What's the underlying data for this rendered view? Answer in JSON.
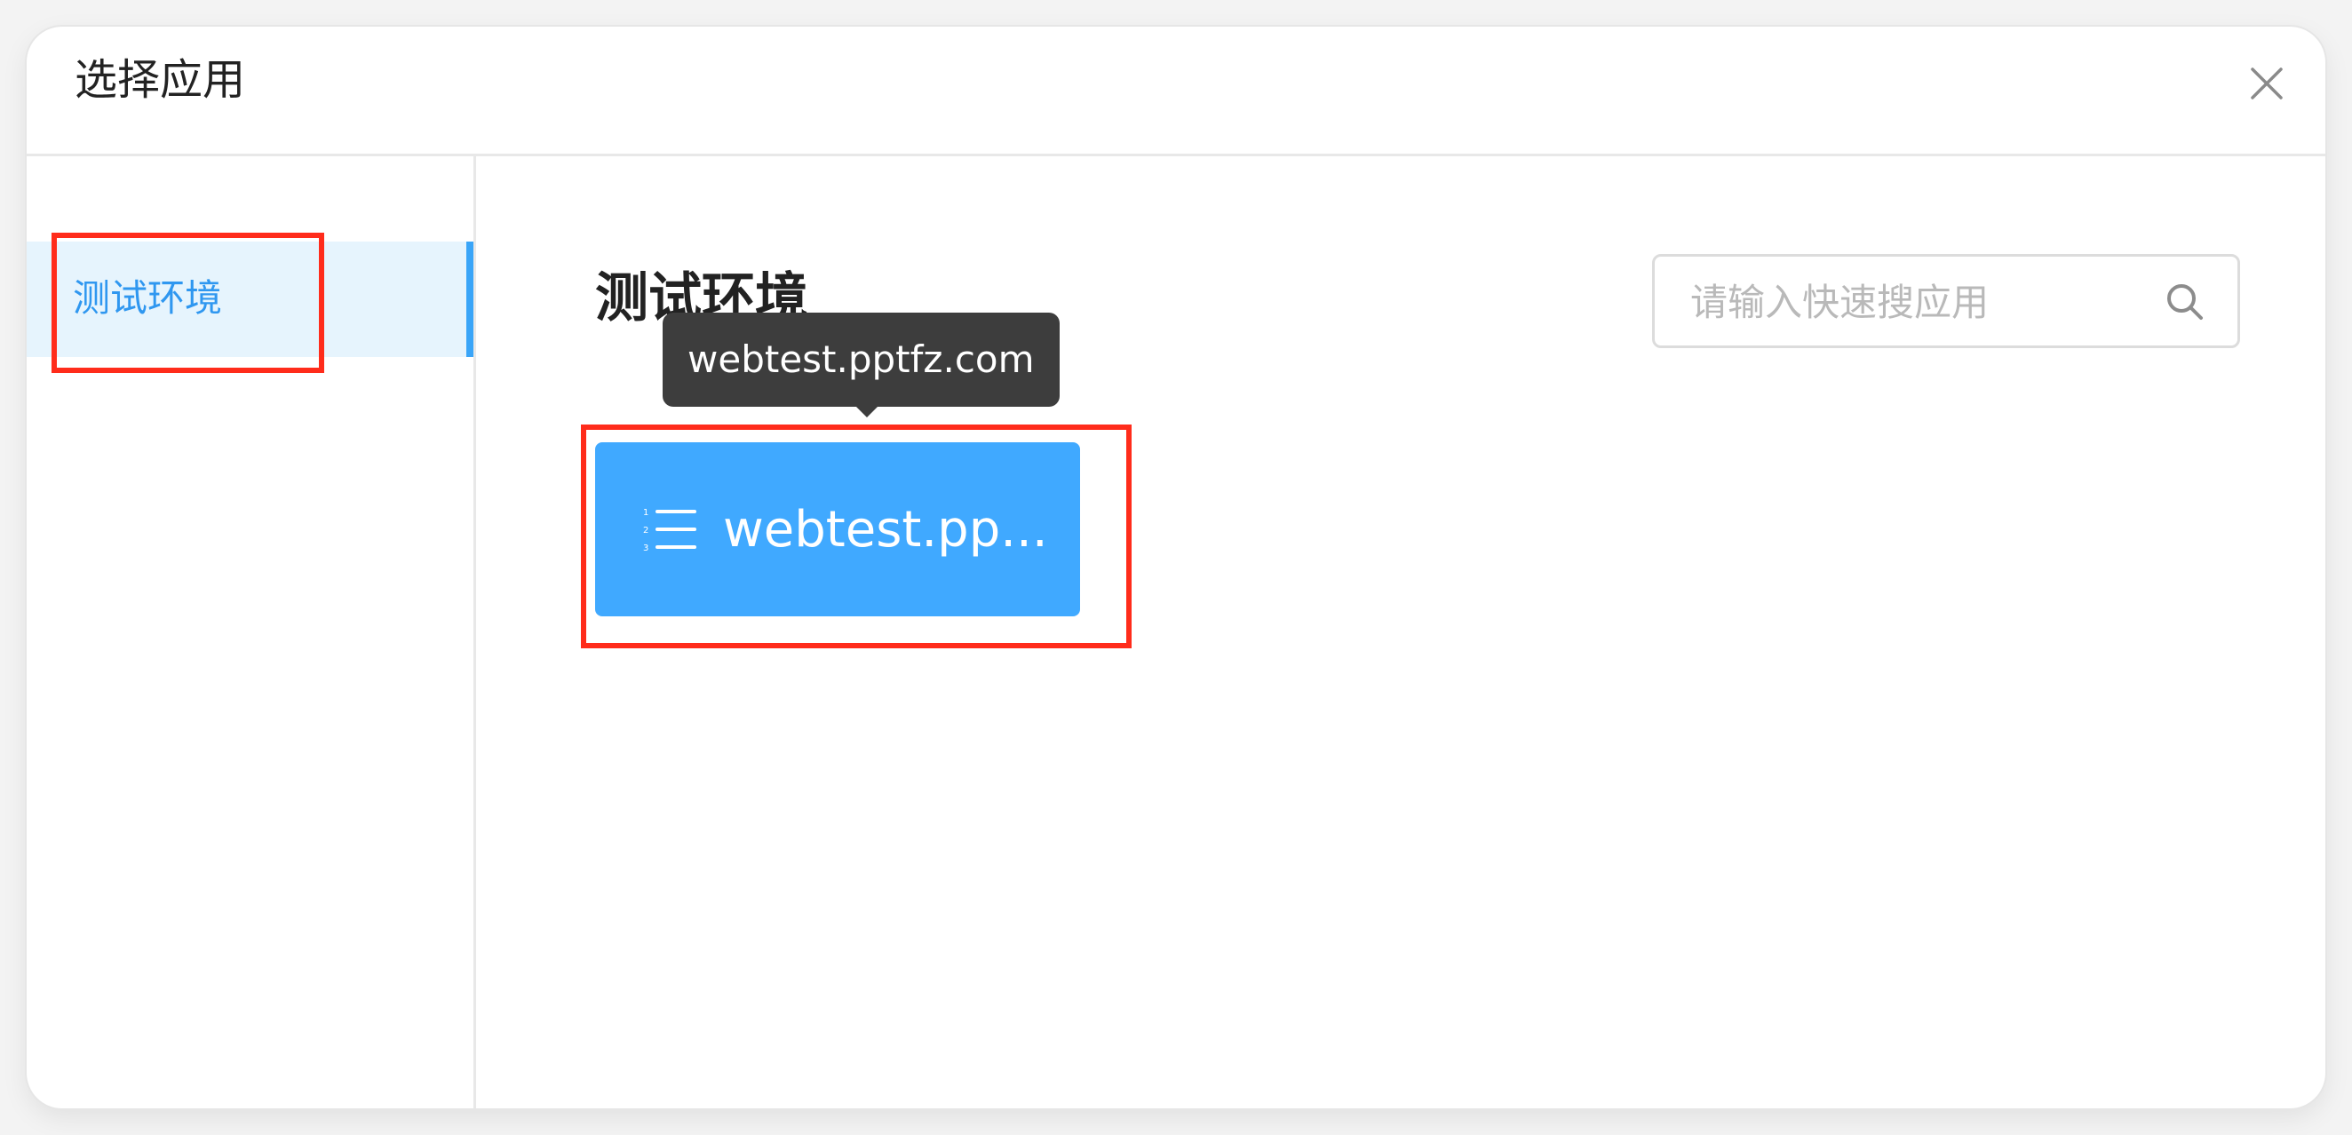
{
  "dialog": {
    "title": "选择应用",
    "close_icon": "close-icon"
  },
  "sidebar": {
    "items": [
      {
        "label": "测试环境",
        "selected": true
      }
    ]
  },
  "main": {
    "section_title": "测试环境",
    "search": {
      "placeholder": "请输入快速搜应用",
      "value": "",
      "icon": "search-icon"
    },
    "apps": [
      {
        "name": "webtest.pptfz.com",
        "display_name": "webtest.pp...",
        "icon": "ordered-list-icon",
        "tooltip": "webtest.pptfz.com"
      }
    ]
  },
  "colors": {
    "accent": "#40a9ff",
    "sidebar_active_bg": "#e6f4fd",
    "sidebar_active_text": "#2f97f0",
    "highlight_box": "#ff2c1b",
    "tooltip_bg": "#3d3d3d"
  }
}
